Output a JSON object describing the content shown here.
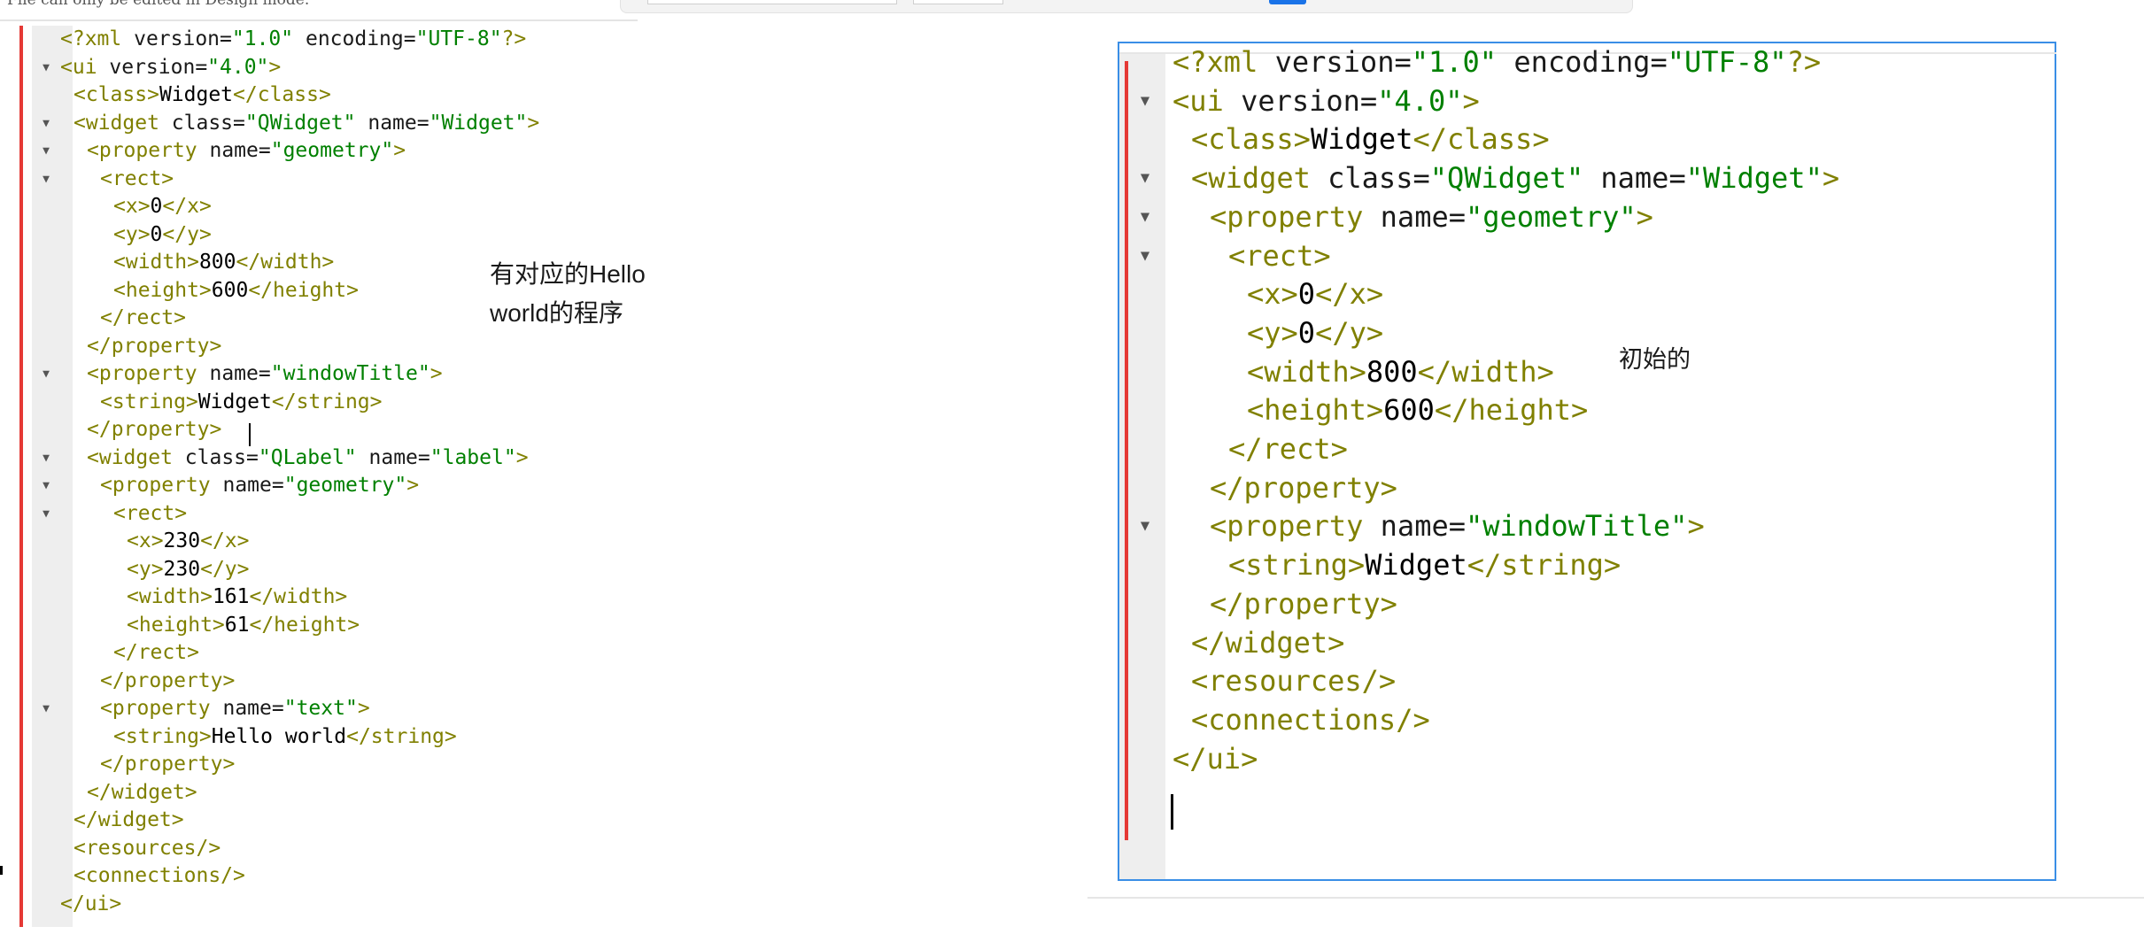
{
  "header_note": "File can only be edited in Design mode.",
  "left_annotation": [
    "有对应的Hello",
    "world的程序"
  ],
  "right_annotation": "初始的",
  "left_code": [
    {
      "fold": false,
      "indent": 0,
      "parts": [
        [
          "tag",
          "<?xml "
        ],
        [
          "attr",
          "version="
        ],
        [
          "val",
          "\"1.0\""
        ],
        [
          "attr",
          " encoding="
        ],
        [
          "val",
          "\"UTF-8\""
        ],
        [
          "tag",
          "?>"
        ]
      ]
    },
    {
      "fold": true,
      "indent": 0,
      "parts": [
        [
          "tag",
          "<ui "
        ],
        [
          "attr",
          "version="
        ],
        [
          "val",
          "\"4.0\""
        ],
        [
          "tag",
          ">"
        ]
      ]
    },
    {
      "fold": false,
      "indent": 1,
      "parts": [
        [
          "tag",
          "<class>"
        ],
        [
          "txt",
          "Widget"
        ],
        [
          "tag",
          "</class>"
        ]
      ]
    },
    {
      "fold": true,
      "indent": 1,
      "parts": [
        [
          "tag",
          "<widget "
        ],
        [
          "attr",
          "class="
        ],
        [
          "val",
          "\"QWidget\""
        ],
        [
          "attr",
          " name="
        ],
        [
          "val",
          "\"Widget\""
        ],
        [
          "tag",
          ">"
        ]
      ]
    },
    {
      "fold": true,
      "indent": 2,
      "parts": [
        [
          "tag",
          "<property "
        ],
        [
          "attr",
          "name="
        ],
        [
          "val",
          "\"geometry\""
        ],
        [
          "tag",
          ">"
        ]
      ]
    },
    {
      "fold": true,
      "indent": 3,
      "parts": [
        [
          "tag",
          "<rect>"
        ]
      ]
    },
    {
      "fold": false,
      "indent": 4,
      "parts": [
        [
          "tag",
          "<x>"
        ],
        [
          "txt",
          "0"
        ],
        [
          "tag",
          "</x>"
        ]
      ]
    },
    {
      "fold": false,
      "indent": 4,
      "parts": [
        [
          "tag",
          "<y>"
        ],
        [
          "txt",
          "0"
        ],
        [
          "tag",
          "</y>"
        ]
      ]
    },
    {
      "fold": false,
      "indent": 4,
      "parts": [
        [
          "tag",
          "<width>"
        ],
        [
          "txt",
          "800"
        ],
        [
          "tag",
          "</width>"
        ]
      ]
    },
    {
      "fold": false,
      "indent": 4,
      "parts": [
        [
          "tag",
          "<height>"
        ],
        [
          "txt",
          "600"
        ],
        [
          "tag",
          "</height>"
        ]
      ]
    },
    {
      "fold": false,
      "indent": 3,
      "parts": [
        [
          "tag",
          "</rect>"
        ]
      ]
    },
    {
      "fold": false,
      "indent": 2,
      "parts": [
        [
          "tag",
          "</property>"
        ]
      ]
    },
    {
      "fold": true,
      "indent": 2,
      "parts": [
        [
          "tag",
          "<property "
        ],
        [
          "attr",
          "name="
        ],
        [
          "val",
          "\"windowTitle\""
        ],
        [
          "tag",
          ">"
        ]
      ]
    },
    {
      "fold": false,
      "indent": 3,
      "parts": [
        [
          "tag",
          "<string>"
        ],
        [
          "txt",
          "Widget"
        ],
        [
          "tag",
          "</string>"
        ]
      ]
    },
    {
      "fold": false,
      "indent": 2,
      "parts": [
        [
          "tag",
          "</property>"
        ]
      ]
    },
    {
      "fold": true,
      "indent": 2,
      "parts": [
        [
          "tag",
          "<widget "
        ],
        [
          "attr",
          "class="
        ],
        [
          "val",
          "\"QLabel\""
        ],
        [
          "attr",
          " name="
        ],
        [
          "val",
          "\"label\""
        ],
        [
          "tag",
          ">"
        ]
      ]
    },
    {
      "fold": true,
      "indent": 3,
      "parts": [
        [
          "tag",
          "<property "
        ],
        [
          "attr",
          "name="
        ],
        [
          "val",
          "\"geometry\""
        ],
        [
          "tag",
          ">"
        ]
      ]
    },
    {
      "fold": true,
      "indent": 4,
      "parts": [
        [
          "tag",
          "<rect>"
        ]
      ]
    },
    {
      "fold": false,
      "indent": 5,
      "parts": [
        [
          "tag",
          "<x>"
        ],
        [
          "txt",
          "230"
        ],
        [
          "tag",
          "</x>"
        ]
      ]
    },
    {
      "fold": false,
      "indent": 5,
      "parts": [
        [
          "tag",
          "<y>"
        ],
        [
          "txt",
          "230"
        ],
        [
          "tag",
          "</y>"
        ]
      ]
    },
    {
      "fold": false,
      "indent": 5,
      "parts": [
        [
          "tag",
          "<width>"
        ],
        [
          "txt",
          "161"
        ],
        [
          "tag",
          "</width>"
        ]
      ]
    },
    {
      "fold": false,
      "indent": 5,
      "parts": [
        [
          "tag",
          "<height>"
        ],
        [
          "txt",
          "61"
        ],
        [
          "tag",
          "</height>"
        ]
      ]
    },
    {
      "fold": false,
      "indent": 4,
      "parts": [
        [
          "tag",
          "</rect>"
        ]
      ]
    },
    {
      "fold": false,
      "indent": 3,
      "parts": [
        [
          "tag",
          "</property>"
        ]
      ]
    },
    {
      "fold": true,
      "indent": 3,
      "parts": [
        [
          "tag",
          "<property "
        ],
        [
          "attr",
          "name="
        ],
        [
          "val",
          "\"text\""
        ],
        [
          "tag",
          ">"
        ]
      ]
    },
    {
      "fold": false,
      "indent": 4,
      "parts": [
        [
          "tag",
          "<string>"
        ],
        [
          "txt",
          "Hello world"
        ],
        [
          "tag",
          "</string>"
        ]
      ]
    },
    {
      "fold": false,
      "indent": 3,
      "parts": [
        [
          "tag",
          "</property>"
        ]
      ]
    },
    {
      "fold": false,
      "indent": 2,
      "parts": [
        [
          "tag",
          "</widget>"
        ]
      ]
    },
    {
      "fold": false,
      "indent": 1,
      "parts": [
        [
          "tag",
          "</widget>"
        ]
      ]
    },
    {
      "fold": false,
      "indent": 1,
      "parts": [
        [
          "tag",
          "<resources/>"
        ]
      ]
    },
    {
      "fold": false,
      "indent": 1,
      "parts": [
        [
          "tag",
          "<connections/>"
        ]
      ]
    },
    {
      "fold": false,
      "indent": 0,
      "parts": [
        [
          "tag",
          "</ui>"
        ]
      ]
    }
  ],
  "right_code": [
    {
      "fold": false,
      "indent": 0,
      "parts": [
        [
          "tag",
          "<?xml "
        ],
        [
          "attr",
          "version="
        ],
        [
          "val",
          "\"1.0\""
        ],
        [
          "attr",
          " encoding="
        ],
        [
          "val",
          "\"UTF-8\""
        ],
        [
          "tag",
          "?>"
        ]
      ]
    },
    {
      "fold": true,
      "indent": 0,
      "parts": [
        [
          "tag",
          "<ui "
        ],
        [
          "attr",
          "version="
        ],
        [
          "val",
          "\"4.0\""
        ],
        [
          "tag",
          ">"
        ]
      ]
    },
    {
      "fold": false,
      "indent": 1,
      "parts": [
        [
          "tag",
          "<class>"
        ],
        [
          "txt",
          "Widget"
        ],
        [
          "tag",
          "</class>"
        ]
      ]
    },
    {
      "fold": true,
      "indent": 1,
      "parts": [
        [
          "tag",
          "<widget "
        ],
        [
          "attr",
          "class="
        ],
        [
          "val",
          "\"QWidget\""
        ],
        [
          "attr",
          " name="
        ],
        [
          "val",
          "\"Widget\""
        ],
        [
          "tag",
          ">"
        ]
      ]
    },
    {
      "fold": true,
      "indent": 2,
      "parts": [
        [
          "tag",
          "<property "
        ],
        [
          "attr",
          "name="
        ],
        [
          "val",
          "\"geometry\""
        ],
        [
          "tag",
          ">"
        ]
      ]
    },
    {
      "fold": true,
      "indent": 3,
      "parts": [
        [
          "tag",
          "<rect>"
        ]
      ]
    },
    {
      "fold": false,
      "indent": 4,
      "parts": [
        [
          "tag",
          "<x>"
        ],
        [
          "txt",
          "0"
        ],
        [
          "tag",
          "</x>"
        ]
      ]
    },
    {
      "fold": false,
      "indent": 4,
      "parts": [
        [
          "tag",
          "<y>"
        ],
        [
          "txt",
          "0"
        ],
        [
          "tag",
          "</y>"
        ]
      ]
    },
    {
      "fold": false,
      "indent": 4,
      "parts": [
        [
          "tag",
          "<width>"
        ],
        [
          "txt",
          "800"
        ],
        [
          "tag",
          "</width>"
        ]
      ]
    },
    {
      "fold": false,
      "indent": 4,
      "parts": [
        [
          "tag",
          "<height>"
        ],
        [
          "txt",
          "600"
        ],
        [
          "tag",
          "</height>"
        ]
      ]
    },
    {
      "fold": false,
      "indent": 3,
      "parts": [
        [
          "tag",
          "</rect>"
        ]
      ]
    },
    {
      "fold": false,
      "indent": 2,
      "parts": [
        [
          "tag",
          "</property>"
        ]
      ]
    },
    {
      "fold": true,
      "indent": 2,
      "parts": [
        [
          "tag",
          "<property "
        ],
        [
          "attr",
          "name="
        ],
        [
          "val",
          "\"windowTitle\""
        ],
        [
          "tag",
          ">"
        ]
      ]
    },
    {
      "fold": false,
      "indent": 3,
      "parts": [
        [
          "tag",
          "<string>"
        ],
        [
          "txt",
          "Widget"
        ],
        [
          "tag",
          "</string>"
        ]
      ]
    },
    {
      "fold": false,
      "indent": 2,
      "parts": [
        [
          "tag",
          "</property>"
        ]
      ]
    },
    {
      "fold": false,
      "indent": 1,
      "parts": [
        [
          "tag",
          "</widget>"
        ]
      ]
    },
    {
      "fold": false,
      "indent": 1,
      "parts": [
        [
          "tag",
          "<resources/>"
        ]
      ]
    },
    {
      "fold": false,
      "indent": 1,
      "parts": [
        [
          "tag",
          "<connections/>"
        ]
      ]
    },
    {
      "fold": false,
      "indent": 0,
      "parts": [
        [
          "tag",
          "</ui>"
        ]
      ]
    }
  ],
  "colors": {
    "tag": "#808000",
    "attr": "#1a1a1a",
    "val": "#008000",
    "txt": "#000000",
    "accent": "#3a8ee6",
    "change_bar": "#e53935"
  },
  "icons": {
    "fold": "fold-arrow-down-icon"
  }
}
